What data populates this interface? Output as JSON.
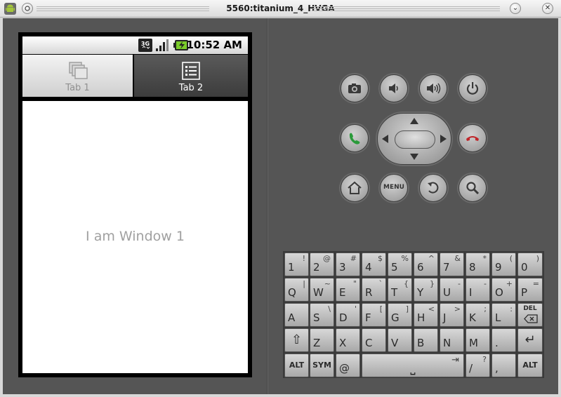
{
  "window": {
    "title": "5560:titanium_4_HVGA",
    "collapse_icon": "⌄",
    "close_icon": "✕"
  },
  "status_bar": {
    "network_type": "3G",
    "time": "10:52 AM"
  },
  "tabs": [
    {
      "label": "Tab 1",
      "selected": true
    },
    {
      "label": "Tab 2",
      "selected": false
    }
  ],
  "content": {
    "text": "I am Window 1"
  },
  "hardware_buttons": {
    "menu_label": "MENU"
  },
  "keyboard": {
    "rows": [
      [
        {
          "main": "1",
          "alt": "!"
        },
        {
          "main": "2",
          "alt": "@"
        },
        {
          "main": "3",
          "alt": "#"
        },
        {
          "main": "4",
          "alt": "$"
        },
        {
          "main": "5",
          "alt": "%"
        },
        {
          "main": "6",
          "alt": "^"
        },
        {
          "main": "7",
          "alt": "&"
        },
        {
          "main": "8",
          "alt": "*"
        },
        {
          "main": "9",
          "alt": "("
        },
        {
          "main": "0",
          "alt": ")"
        }
      ],
      [
        {
          "main": "Q",
          "alt": "|"
        },
        {
          "main": "W",
          "alt": "~"
        },
        {
          "main": "E",
          "alt": "\""
        },
        {
          "main": "R",
          "alt": "`"
        },
        {
          "main": "T",
          "alt": "{"
        },
        {
          "main": "Y",
          "alt": "}"
        },
        {
          "main": "U",
          "alt": "-"
        },
        {
          "main": "I",
          "alt": "-"
        },
        {
          "main": "O",
          "alt": "+"
        },
        {
          "main": "P",
          "alt": "="
        }
      ],
      [
        {
          "main": "A",
          "alt": ""
        },
        {
          "main": "S",
          "alt": "\\"
        },
        {
          "main": "D",
          "alt": "'"
        },
        {
          "main": "F",
          "alt": "["
        },
        {
          "main": "G",
          "alt": "]"
        },
        {
          "main": "H",
          "alt": "<"
        },
        {
          "main": "J",
          "alt": ">"
        },
        {
          "main": "K",
          "alt": ";"
        },
        {
          "main": "L",
          "alt": ":"
        },
        {
          "main": "DEL",
          "alt": ""
        }
      ],
      [
        {
          "main": "⇧",
          "alt": ""
        },
        {
          "main": "Z",
          "alt": ""
        },
        {
          "main": "X",
          "alt": ""
        },
        {
          "main": "C",
          "alt": ""
        },
        {
          "main": "V",
          "alt": ""
        },
        {
          "main": "B",
          "alt": ""
        },
        {
          "main": "N",
          "alt": ""
        },
        {
          "main": "M",
          "alt": ""
        },
        {
          "main": ".",
          "alt": ""
        },
        {
          "main": "↵",
          "alt": ""
        }
      ],
      [
        {
          "main": "ALT",
          "alt": ""
        },
        {
          "main": "SYM",
          "alt": ""
        },
        {
          "main": "@",
          "alt": ""
        },
        {
          "main": "⎵",
          "alt": "⇥"
        },
        {
          "main": "/",
          "alt": "?"
        },
        {
          "main": ",",
          "alt": ""
        },
        {
          "main": "ALT",
          "alt": ""
        }
      ]
    ]
  },
  "colors": {
    "emulator_body": "#555555",
    "call_green": "#2a9a3a",
    "end_call_red": "#c0262a"
  }
}
